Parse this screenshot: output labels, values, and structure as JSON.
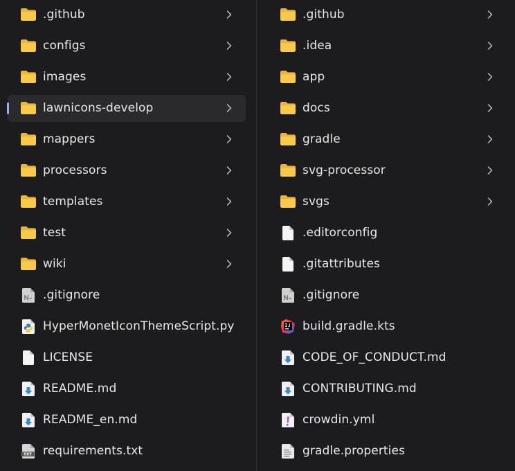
{
  "left_column": {
    "items": [
      {
        "label": ".github",
        "kind": "folder",
        "icon": "folder-icon"
      },
      {
        "label": "configs",
        "kind": "folder",
        "icon": "folder-icon"
      },
      {
        "label": "images",
        "kind": "folder",
        "icon": "folder-icon"
      },
      {
        "label": "lawnicons-develop",
        "kind": "folder",
        "icon": "folder-icon",
        "selected": true
      },
      {
        "label": "mappers",
        "kind": "folder",
        "icon": "folder-icon"
      },
      {
        "label": "processors",
        "kind": "folder",
        "icon": "folder-icon"
      },
      {
        "label": "templates",
        "kind": "folder",
        "icon": "folder-icon"
      },
      {
        "label": "test",
        "kind": "folder",
        "icon": "folder-icon"
      },
      {
        "label": "wiki",
        "kind": "folder",
        "icon": "folder-icon"
      },
      {
        "label": ".gitignore",
        "kind": "file",
        "icon": "gitignore-file-icon"
      },
      {
        "label": "HyperMonetIconThemeScript.py",
        "kind": "file",
        "icon": "python-file-icon"
      },
      {
        "label": "LICENSE",
        "kind": "file",
        "icon": "blank-file-icon"
      },
      {
        "label": "README.md",
        "kind": "file",
        "icon": "markdown-file-icon"
      },
      {
        "label": "README_en.md",
        "kind": "file",
        "icon": "markdown-file-icon"
      },
      {
        "label": "requirements.txt",
        "kind": "file",
        "icon": "text-file-icon"
      }
    ]
  },
  "right_column": {
    "items": [
      {
        "label": ".github",
        "kind": "folder",
        "icon": "folder-icon"
      },
      {
        "label": ".idea",
        "kind": "folder",
        "icon": "folder-icon"
      },
      {
        "label": "app",
        "kind": "folder",
        "icon": "folder-icon"
      },
      {
        "label": "docs",
        "kind": "folder",
        "icon": "folder-icon"
      },
      {
        "label": "gradle",
        "kind": "folder",
        "icon": "folder-icon"
      },
      {
        "label": "svg-processor",
        "kind": "folder",
        "icon": "folder-icon"
      },
      {
        "label": "svgs",
        "kind": "folder",
        "icon": "folder-icon"
      },
      {
        "label": ".editorconfig",
        "kind": "file",
        "icon": "blank-file-icon"
      },
      {
        "label": ".gitattributes",
        "kind": "file",
        "icon": "blank-file-icon"
      },
      {
        "label": ".gitignore",
        "kind": "file",
        "icon": "gitignore-file-icon"
      },
      {
        "label": "build.gradle.kts",
        "kind": "file",
        "icon": "intellij-file-icon"
      },
      {
        "label": "CODE_OF_CONDUCT.md",
        "kind": "file",
        "icon": "markdown-file-icon"
      },
      {
        "label": "CONTRIBUTING.md",
        "kind": "file",
        "icon": "markdown-file-icon"
      },
      {
        "label": "crowdin.yml",
        "kind": "file",
        "icon": "yaml-file-icon"
      },
      {
        "label": "gradle.properties",
        "kind": "file",
        "icon": "properties-file-icon"
      }
    ]
  },
  "colors": {
    "background": "#1c1c1e",
    "selected_row": "#2a2a2c",
    "selection_accent": "#8fb6e8",
    "folder": "#f6c545",
    "text": "#e8e8e8"
  }
}
